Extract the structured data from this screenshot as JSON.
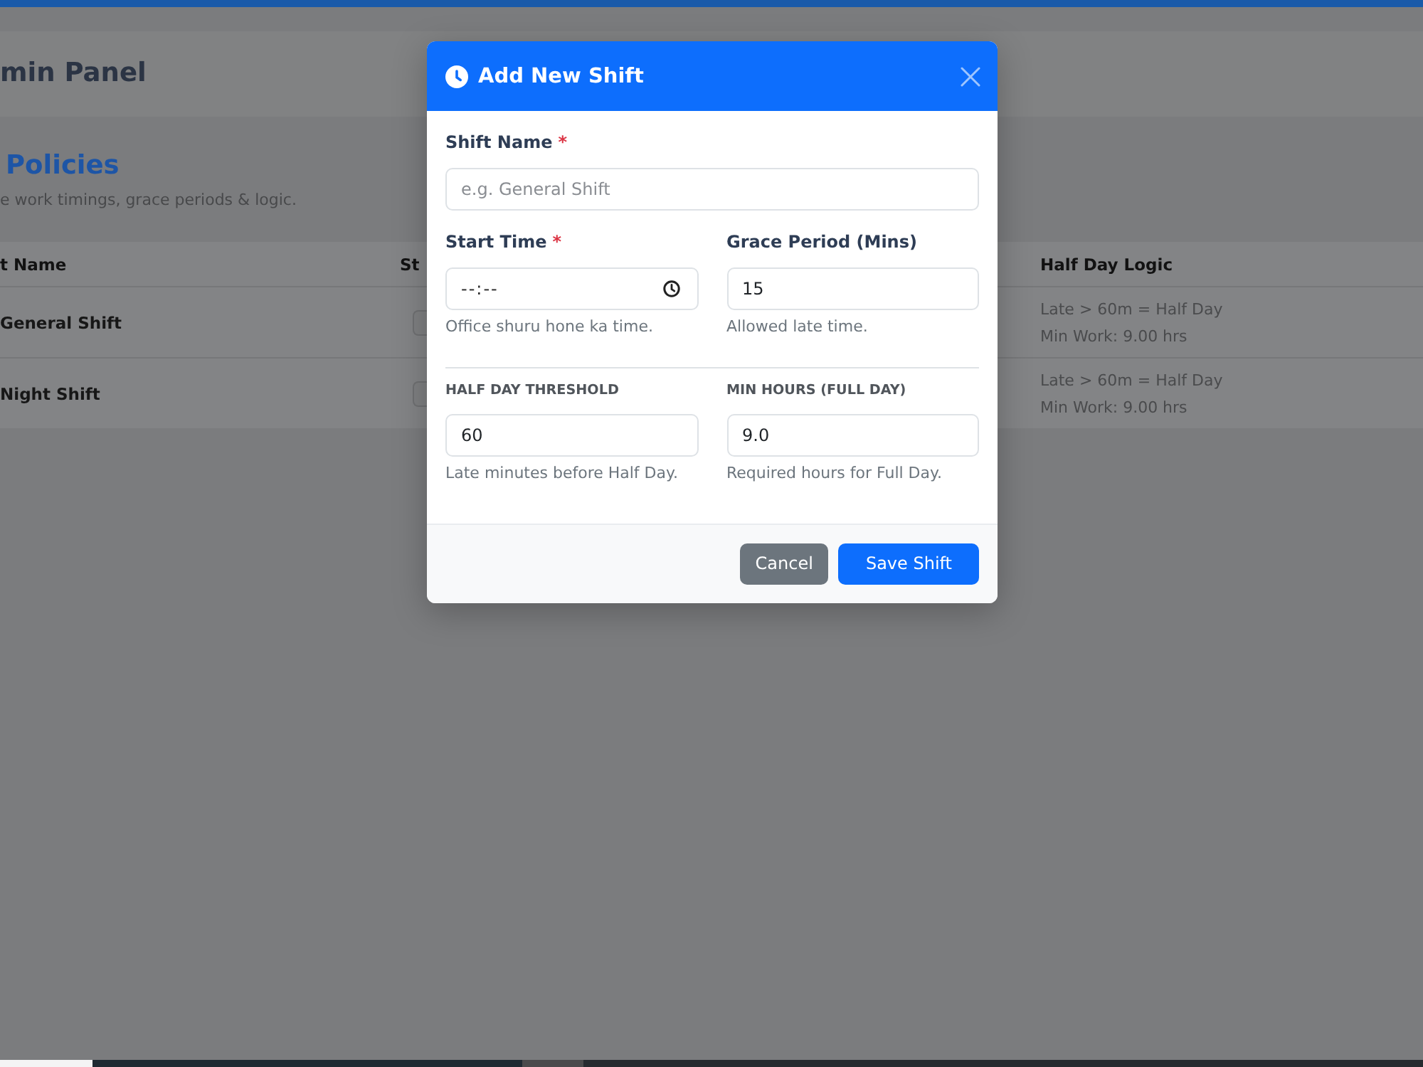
{
  "header": {
    "title": "min Panel"
  },
  "section": {
    "title": "Policies",
    "subtitle": "e work timings, grace periods & logic."
  },
  "table": {
    "columns": [
      "t Name",
      "St",
      "Half Day Logic"
    ],
    "rows": [
      {
        "name": "General Shift",
        "half_day_logic": [
          "Late > 60m = Half Day",
          "Min Work: 9.00 hrs"
        ]
      },
      {
        "name": "Night Shift",
        "half_day_logic": [
          "Late > 60m = Half Day",
          "Min Work: 9.00 hrs"
        ]
      }
    ]
  },
  "modal": {
    "title": "Add New Shift",
    "name_field": {
      "kind": "input",
      "label": "Shift Name",
      "required_mark": "*",
      "placeholder": "e.g. General Shift"
    },
    "timing_fields": [
      {
        "kind": "time",
        "label": "Start Time",
        "required_mark": "*",
        "placeholder": "--:--",
        "help": "Office shuru hone ka time."
      },
      {
        "kind": "input",
        "label": "Grace Period (Mins)",
        "value": "15",
        "help": "Allowed late time."
      }
    ],
    "logic_fields": [
      {
        "kind": "input",
        "label": "HALF DAY THRESHOLD",
        "value": "60",
        "help": "Late minutes before Half Day."
      },
      {
        "kind": "input",
        "label": "MIN HOURS (FULL DAY)",
        "value": "9.0",
        "help": "Required hours for Full Day."
      }
    ],
    "buttons": [
      {
        "kind": "secondary",
        "label": "Cancel"
      },
      {
        "kind": "primary",
        "label": "Save Shift"
      }
    ]
  }
}
